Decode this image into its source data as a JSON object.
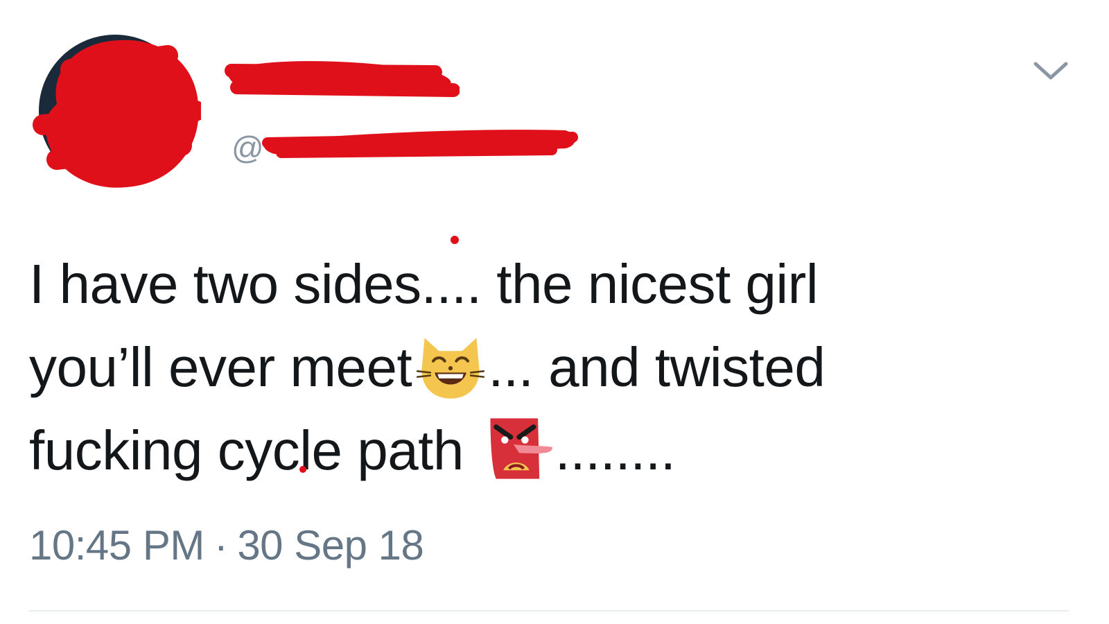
{
  "tweet": {
    "handle_prefix": "@",
    "menu_icon": "chevron-down-icon",
    "text_lines": [
      {
        "before": "I have two sides.... the nicest girl",
        "after": ""
      },
      {
        "before": "you’ll ever meet",
        "after": "... and twisted"
      },
      {
        "before": "fucking cycle path ",
        "after": "........"
      }
    ],
    "emojis": [
      "grinning-cat-icon",
      "tengu-mask-icon"
    ],
    "time": "10:45 PM",
    "separator": "·",
    "date": "30 Sep 18"
  },
  "colors": {
    "text": "#14171a",
    "meta": "#657786",
    "redaction": "#e0101a"
  }
}
